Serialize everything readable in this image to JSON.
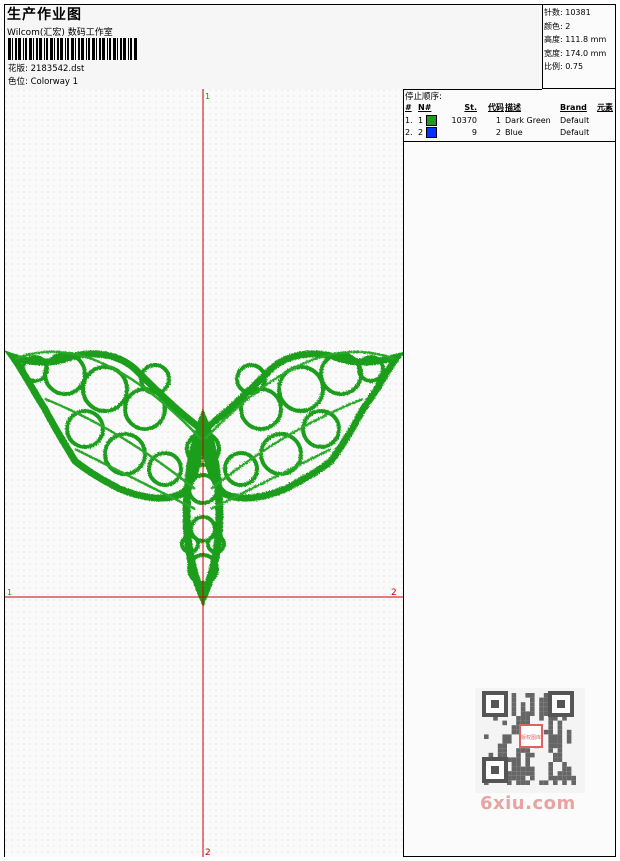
{
  "header": {
    "title": "生产作业图",
    "company": "Wilcom(汇宏) 数码工作室",
    "design_label": "花版: 2183542.dst",
    "colorway_label": "色位: Colorway 1"
  },
  "stats": {
    "stitches": "针数: 10381",
    "colors": "颜色: 2",
    "height": "高度: 111.8 mm",
    "width": "宽度: 174.0 mm",
    "scale": "比例: 0.75"
  },
  "canvas": {
    "marker_top": "1",
    "marker_left": "1",
    "marker_right": "2",
    "marker_bottom": "2",
    "guide_color": "#cc0000",
    "design_color": "#1a9e1a"
  },
  "stop_sequence": {
    "title": "停止顺序:",
    "headers": [
      "#",
      "N#",
      "St.",
      "代码",
      "描述",
      "Brand",
      "元素"
    ],
    "rows": [
      {
        "num": "1.",
        "n": "1",
        "color": "#1f9a1f",
        "stitches": "10370",
        "code": "1",
        "description": "Dark Green",
        "brand": "Default",
        "element": ""
      },
      {
        "num": "2.",
        "n": "2",
        "color": "#0033ff",
        "stitches": "9",
        "code": "2",
        "description": "Blue",
        "brand": "Default",
        "element": ""
      }
    ]
  },
  "watermark": {
    "site": "6xiu.com",
    "seal_text": "版权图库",
    "accent": "#e06060"
  }
}
